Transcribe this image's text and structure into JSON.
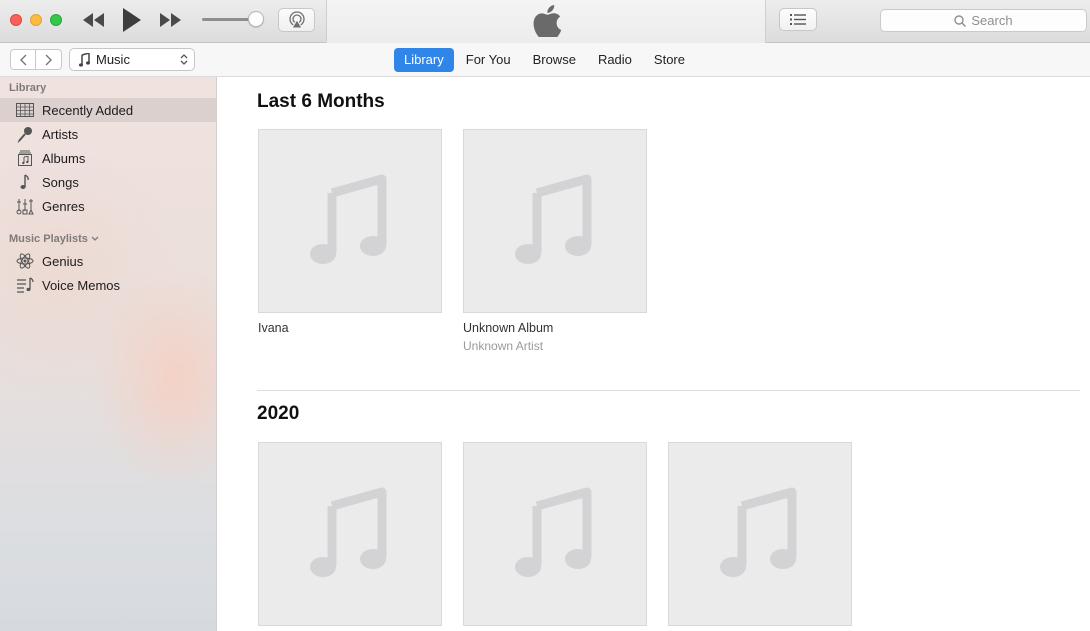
{
  "window": {
    "controls": [
      "close",
      "minimize",
      "maximize"
    ],
    "transport": {
      "previous_icon": "rewind-icon",
      "play_icon": "play-icon",
      "next_icon": "fast-forward-icon"
    },
    "volume_level": 0.82,
    "airplay_icon": "airplay-icon",
    "center_logo": "apple-logo",
    "list_icon": "up-next-list-icon",
    "search": {
      "placeholder": "Search"
    }
  },
  "navbar": {
    "media_select": "Music",
    "tabs": [
      {
        "label": "Library",
        "active": true
      },
      {
        "label": "For You",
        "active": false
      },
      {
        "label": "Browse",
        "active": false
      },
      {
        "label": "Radio",
        "active": false
      },
      {
        "label": "Store",
        "active": false
      }
    ]
  },
  "sidebar": {
    "library_heading": "Library",
    "library_items": [
      {
        "label": "Recently Added",
        "icon": "grid-icon",
        "selected": true
      },
      {
        "label": "Artists",
        "icon": "microphone-icon",
        "selected": false
      },
      {
        "label": "Albums",
        "icon": "album-icon",
        "selected": false
      },
      {
        "label": "Songs",
        "icon": "note-icon",
        "selected": false
      },
      {
        "label": "Genres",
        "icon": "genres-icon",
        "selected": false
      }
    ],
    "playlists_heading": "Music Playlists",
    "playlist_items": [
      {
        "label": "Genius",
        "icon": "atom-icon"
      },
      {
        "label": "Voice Memos",
        "icon": "playlist-icon"
      }
    ]
  },
  "sections": [
    {
      "title": "Last 6 Months",
      "albums": [
        {
          "title": "Ivana",
          "artist": ""
        },
        {
          "title": "Unknown Album",
          "artist": "Unknown Artist"
        }
      ]
    },
    {
      "title": "2020",
      "albums": [
        {
          "title": "",
          "artist": ""
        },
        {
          "title": "",
          "artist": ""
        },
        {
          "title": "",
          "artist": ""
        }
      ]
    }
  ],
  "colors": {
    "accent": "#2f86e8",
    "art_placeholder": "#ebebeb",
    "note_glyph": "#d3d3d6"
  }
}
